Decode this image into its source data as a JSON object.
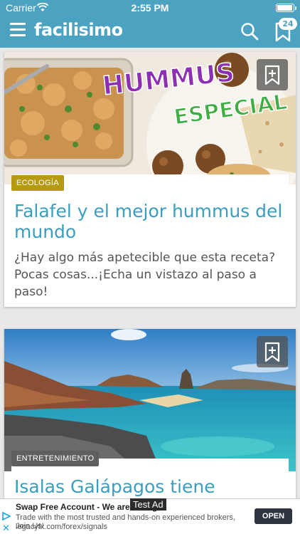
{
  "status_bar": {
    "carrier": "Carrier",
    "time": "2:55 PM",
    "battery_level": 1.0
  },
  "app_bar": {
    "logo": "facilisimo",
    "saved_count": "24"
  },
  "feed": [
    {
      "category": "ECOLOGÍA",
      "category_color": "#b59a12",
      "title": "Falafel y el mejor hummus del mundo",
      "description": "¿Hay algo más apetecible que esta receta? Pocas cosas...¡Echa un vistazo al paso a paso!",
      "image_text_1": "HUMMUS",
      "image_text_2": "ESPECIAL"
    },
    {
      "category": "ENTRETENIMIENTO",
      "category_color": "#5f5f5f",
      "title": "Isalas Galápagos tiene"
    }
  ],
  "ad": {
    "title": "Swap Free Account - We are taking",
    "test_label": "Test Ad",
    "text": "Trade with the most trusted and hands-on experienced brokers, Join Us!",
    "url": "legacyfx.com/forex/signals",
    "open_label": "OPEN"
  },
  "colors": {
    "brand": "#4ba3c1",
    "title": "#3b9dbf"
  }
}
